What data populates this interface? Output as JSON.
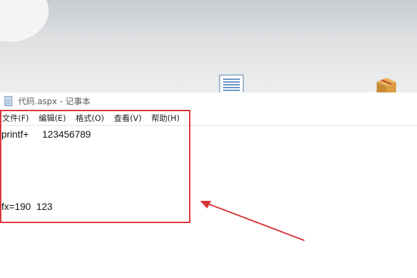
{
  "window": {
    "title": "代码.aspx - 记事本"
  },
  "menu": {
    "items": [
      "文件(F)",
      "编辑(E)",
      "格式(O)",
      "查看(V)",
      "帮助(H)"
    ]
  },
  "editor": {
    "lines": [
      "printf+     123456789",
      "fx=190  123"
    ]
  },
  "icons": {
    "desktop_document": "document-icon",
    "desktop_box": "package-icon",
    "title_icon": "notepad-icon"
  },
  "colors": {
    "highlight": "#d9343b"
  }
}
